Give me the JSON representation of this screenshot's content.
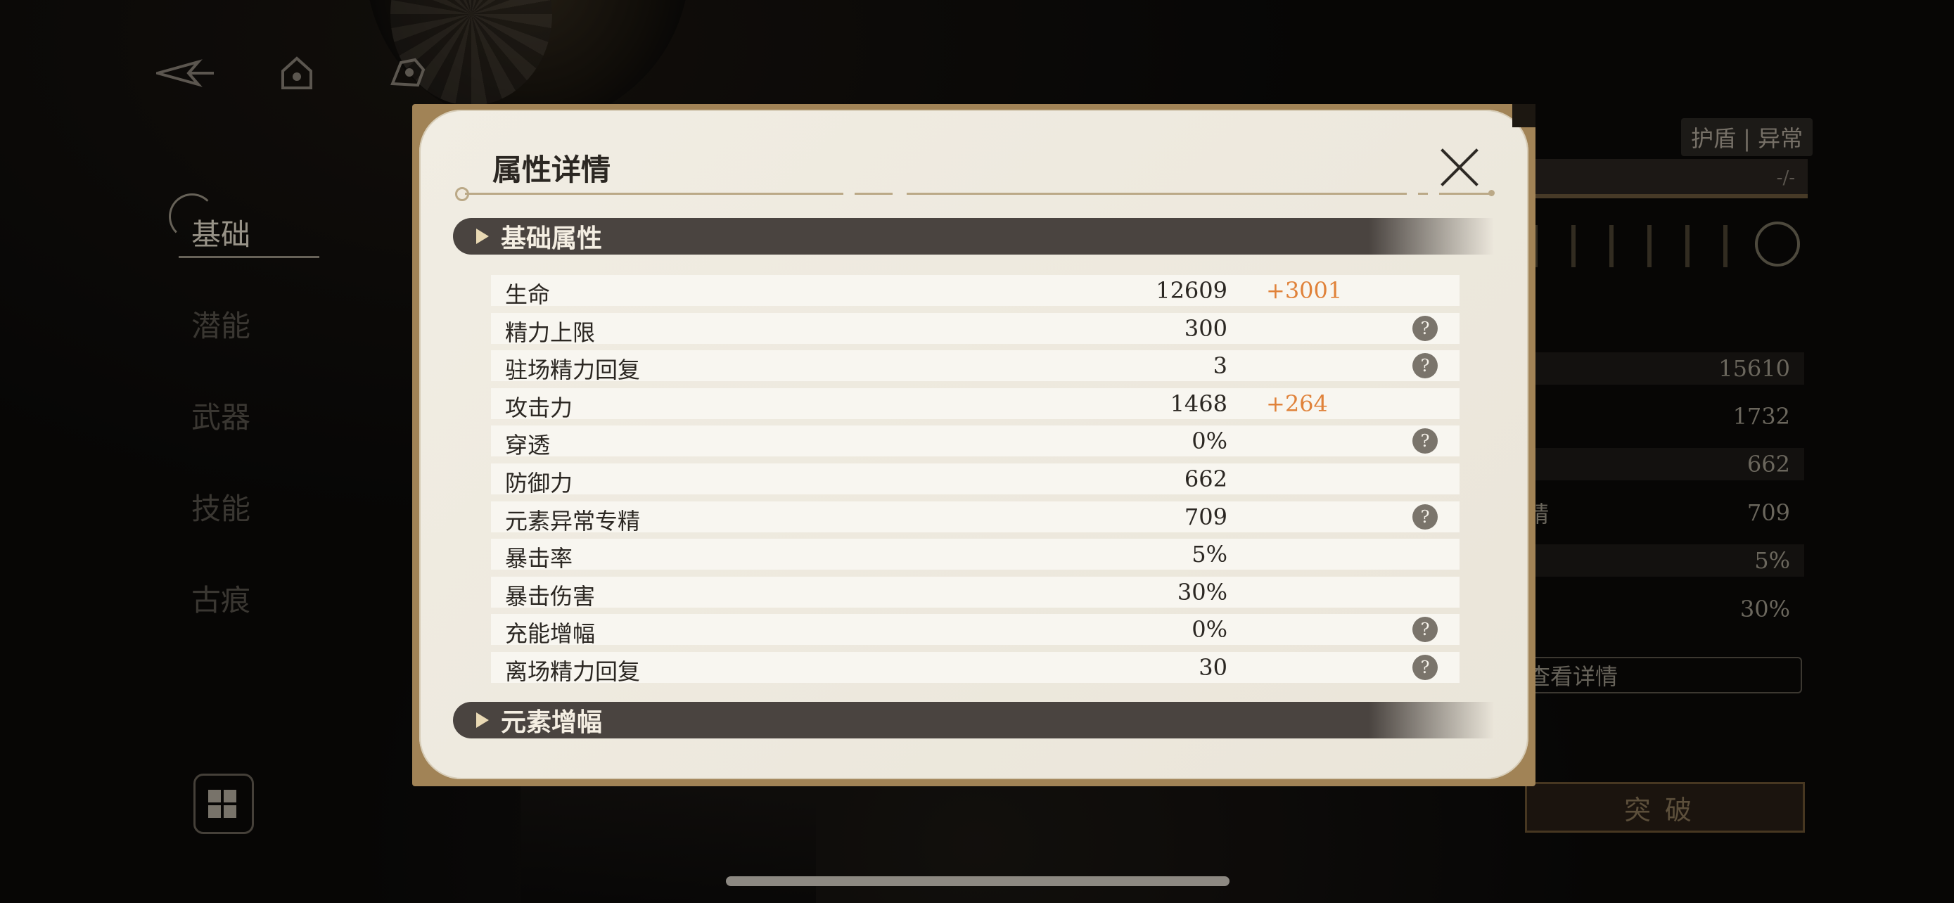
{
  "left_tabs": [
    "基础",
    "潜能",
    "武器",
    "技能",
    "古痕"
  ],
  "right_panel": {
    "badge": "护盾 | 异常",
    "bar_value": "-/-",
    "stats": [
      {
        "label": "",
        "value": "15610"
      },
      {
        "label": "",
        "value": "1732"
      },
      {
        "label": "",
        "value": "662"
      },
      {
        "label": "精",
        "value": "709"
      },
      {
        "label": "",
        "value": "5%"
      },
      {
        "label": "",
        "value": "30%"
      }
    ],
    "detail_button": "查看详情",
    "break_button": "突破"
  },
  "modal": {
    "title": "属性详情",
    "section_basic": "基础属性",
    "section_elemental": "元素增幅",
    "help_glyph": "?",
    "rows": [
      {
        "name": "生命",
        "value": "12609",
        "bonus": "+3001",
        "help": false
      },
      {
        "name": "精力上限",
        "value": "300",
        "bonus": "",
        "help": true
      },
      {
        "name": "驻场精力回复",
        "value": "3",
        "bonus": "",
        "help": true
      },
      {
        "name": "攻击力",
        "value": "1468",
        "bonus": "+264",
        "help": false
      },
      {
        "name": "穿透",
        "value": "0%",
        "bonus": "",
        "help": true
      },
      {
        "name": "防御力",
        "value": "662",
        "bonus": "",
        "help": false
      },
      {
        "name": "元素异常专精",
        "value": "709",
        "bonus": "",
        "help": true
      },
      {
        "name": "暴击率",
        "value": "5%",
        "bonus": "",
        "help": false
      },
      {
        "name": "暴击伤害",
        "value": "30%",
        "bonus": "",
        "help": false
      },
      {
        "name": "充能增幅",
        "value": "0%",
        "bonus": "",
        "help": true
      },
      {
        "name": "离场精力回复",
        "value": "30",
        "bonus": "",
        "help": true
      }
    ]
  },
  "colors": {
    "accent_bonus": "#e0823a",
    "section_header": "#4a4440",
    "modal_bg": "#f1ede3",
    "frame_gold": "#a18356"
  }
}
